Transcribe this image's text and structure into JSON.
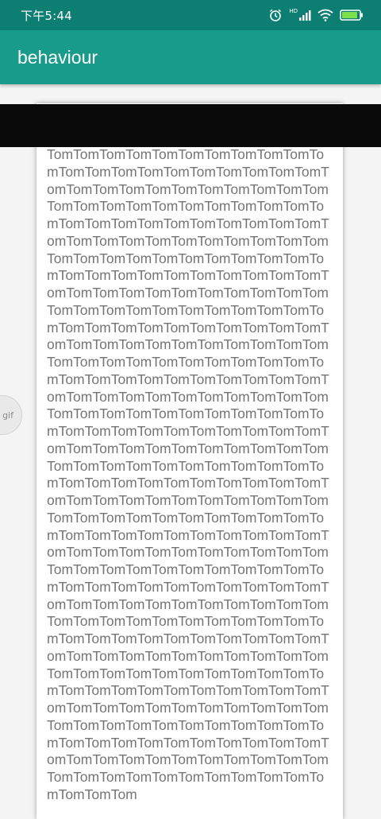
{
  "status_bar": {
    "time": "下午5:44",
    "hd_label": "HD",
    "icons": [
      "alarm-icon",
      "hd-signal-icon",
      "wifi-icon",
      "battery-icon"
    ],
    "background": "#0d7e72"
  },
  "app_bar": {
    "title": "behaviour",
    "background": "#199b8b"
  },
  "content": {
    "text": "TomTomTomTomTomTomTomTomTomTomTomTomTomTomTomTomTomTomTomTomTomTomTomTomTomTomTomTomTomTomTomTomTomTomTomTomTomTomTomTomTomTomTomTomTomTomTomTomTomTomTomTomTomTomTomTomTomTomTomTomTomTomTomTomTomTomTomTomTomTomTomTomTomTomTomTomTomTomTomTomTomTomTomTomTomTomTomTomTomTomTomTomTomTomTomTomTomTomTomTomTomTomTomTomTomTomTomTomTomTomTomTomTomTomTomTomTomTomTomTomTomTomTomTomTomTomTomTomTomTomTomTomTomTomTomTomTomTomTomTomTomTomTomTomTomTomTomTomTomTomTomTomTomTomTomTomTomTomTomTomTomTomTomTomTomTomTomTomTomTomTomTomTomTomTomTomTomTomTomTomTomTomTomTomTomTomTomTomTomTomTomTomTomTomTomTomTomTomTomTomTomTomTomTomTomTomTomTomTomTomTomTomTomTomTomTomTomTomTomTomTomTomTomTomTomTomTomTomTomTomTomTomTomTomTomTomTomTomTomTomTomTomTomTomTomTomTomTomTomTomTomTomTomTomTomTomTomTomTomTomTomTomTomTomTomTomTomTomTomTomTomTomTomTomTomTomTomTomTomTomTomTomTomTomTomTomTomTomTomTomTomTomTomTomTomTomTomTomTomTomTomTomTomTomTomTomTomTomTomTomTomTomTomTomTomTomTomTomTomTomTomTomTomTomTomTomTomTomTomTomTomTomTomTomTomTomTomTomTomTomTomTomTomTomTomTomTomTomTomTomTomTomTomTomTomTomTomTomTomTomTomTomTomTomTomTomTomTomTomTomTomTomTomTomTomTomTomTomTomTomTomTomTomTomTomTomTomTomTomTomTomTomTomTomTomTomTomTom",
    "text_color": "#757575"
  },
  "overlay": {
    "gif_label": "gif"
  }
}
